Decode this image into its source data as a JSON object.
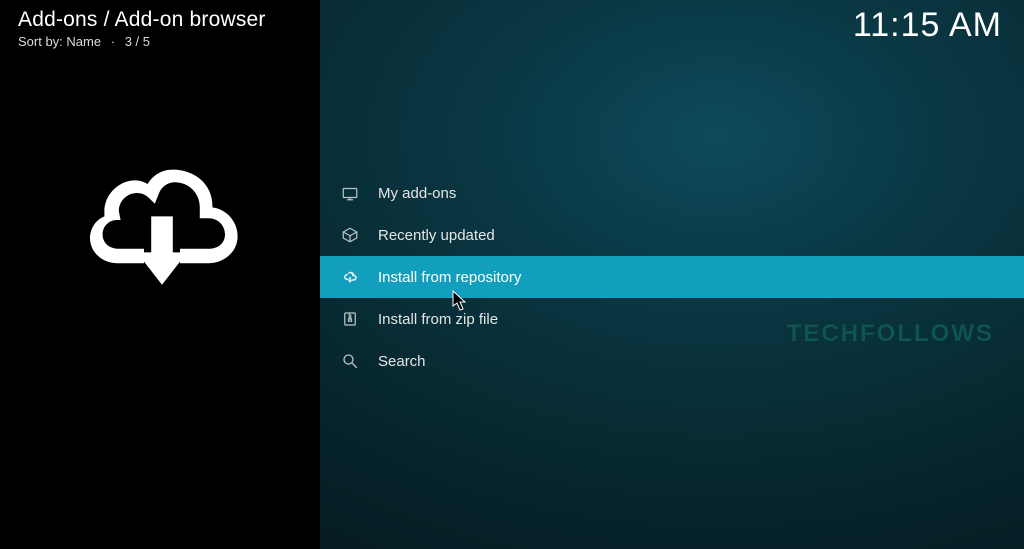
{
  "header": {
    "breadcrumb": "Add-ons / Add-on browser",
    "sort_prefix": "Sort by:",
    "sort_value": "Name",
    "position": "3 / 5",
    "clock": "11:15 AM"
  },
  "menu": {
    "items": [
      {
        "label": "My add-ons",
        "icon": "tv-icon",
        "selected": false
      },
      {
        "label": "Recently updated",
        "icon": "box-icon",
        "selected": false
      },
      {
        "label": "Install from repository",
        "icon": "cloud-download-icon",
        "selected": true
      },
      {
        "label": "Install from zip file",
        "icon": "zip-icon",
        "selected": false
      },
      {
        "label": "Search",
        "icon": "search-icon",
        "selected": false
      }
    ]
  },
  "watermark": "TECHFOLLOWS",
  "accent_color": "#129fbd"
}
